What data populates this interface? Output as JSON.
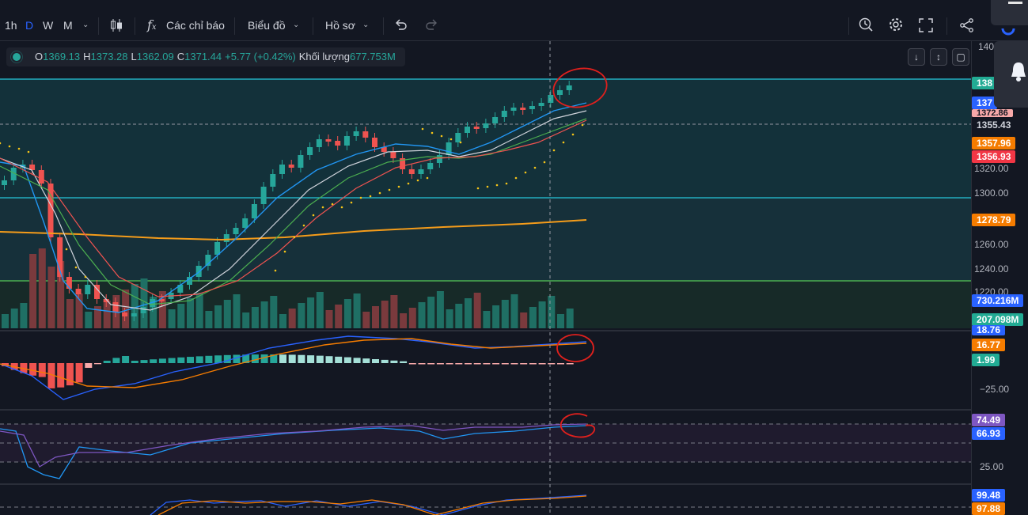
{
  "toolbar": {
    "timeframes": [
      "1h",
      "D",
      "W",
      "M"
    ],
    "active_timeframe": "D",
    "indicators_label": "Các chỉ báo",
    "chart_type_label": "Biểu đồ",
    "profile_label": "Hồ sơ"
  },
  "legend": {
    "o_label": "O",
    "o_value": "1369.13",
    "h_label": "H",
    "h_value": "1373.28",
    "l_label": "L",
    "l_value": "1362.09",
    "c_label": "C",
    "c_value": "1371.44",
    "change": "+5.77 (+0.42%)",
    "volume_label": "Khối lượng",
    "volume_value": "677.753M"
  },
  "price_axis": {
    "ticks": [
      "1320.00",
      "1300.00",
      "1260.00",
      "1240.00",
      "1220.00"
    ],
    "tags": [
      {
        "label": "1355.43",
        "color": "#131722"
      },
      {
        "label": "1357.96",
        "color": "#f57c00"
      },
      {
        "label": "1356.93",
        "color": "#f23645"
      },
      {
        "label": "1278.79",
        "color": "#f57c00"
      },
      {
        "label": "730.216M",
        "color": "#2962ff"
      },
      {
        "label": "207.098M",
        "color": "#22ab94"
      }
    ],
    "partial_tags": [
      "140",
      "138",
      "137",
      "1372.86"
    ]
  },
  "macd_axis": {
    "ticks": [
      "−25.00"
    ],
    "tags": [
      {
        "label": "18.76",
        "color": "#2962ff"
      },
      {
        "label": "16.77",
        "color": "#f57c00"
      },
      {
        "label": "1.99",
        "color": "#22ab94"
      }
    ]
  },
  "rsi_axis": {
    "ticks": [
      "25.00"
    ],
    "tags": [
      {
        "label": "74.49",
        "color": "#7e57c2"
      },
      {
        "label": "66.93",
        "color": "#2962ff"
      }
    ]
  },
  "stoch_axis": {
    "tags": [
      {
        "label": "99.48",
        "color": "#2962ff"
      },
      {
        "label": "97.88",
        "color": "#f57c00"
      }
    ]
  },
  "colors": {
    "up": "#26a69a",
    "down": "#ef5350",
    "ma_long": "#f59c1a",
    "sar": "#f5c518",
    "annotation": "#e0201d"
  },
  "icons": [
    "candles-icon",
    "fx-icon",
    "undo-icon",
    "redo-icon",
    "replay-icon",
    "gear-icon",
    "fullscreen-icon",
    "share-icon",
    "bell-icon"
  ]
}
